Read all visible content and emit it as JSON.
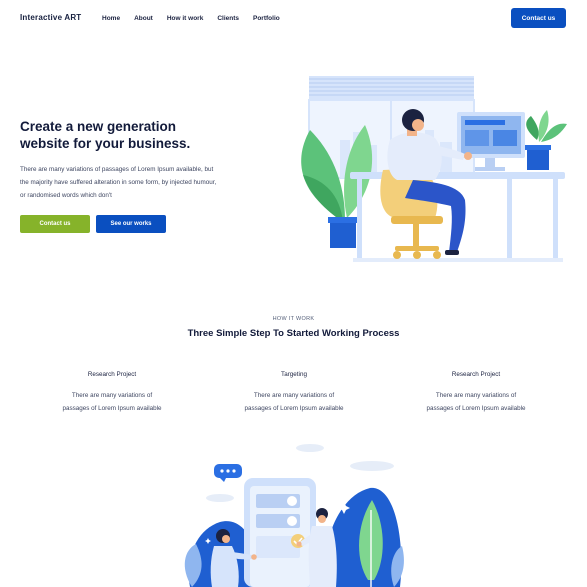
{
  "header": {
    "brand": "Interactive ART",
    "nav": [
      "Home",
      "About",
      "How it work",
      "Clients",
      "Portfolio"
    ],
    "cta": "Contact us"
  },
  "hero": {
    "title": "Create a new generation website for your business.",
    "description": "There are many variations of passages of Lorem Ipsum available, but the majority have suffered alteration in some form, by injected humour, or randomised words which don't",
    "primary_button": "Contact us",
    "secondary_button": "See our works"
  },
  "how_it_works": {
    "eyebrow": "HOW IT WORK",
    "title": "Three Simple Step To Started Working Process",
    "steps": [
      {
        "title": "Research Project",
        "line1": "There are many variations of",
        "line2": "passages of Lorem Ipsum available"
      },
      {
        "title": "Targeting",
        "line1": "There are many variations of",
        "line2": "passages of Lorem Ipsum available"
      },
      {
        "title": "Research Project",
        "line1": "There are many variations of",
        "line2": "passages of Lorem Ipsum available"
      }
    ]
  },
  "colors": {
    "primary_blue": "#0a4fc0",
    "accent_green": "#86b32a",
    "text_dark": "#121a3a"
  }
}
